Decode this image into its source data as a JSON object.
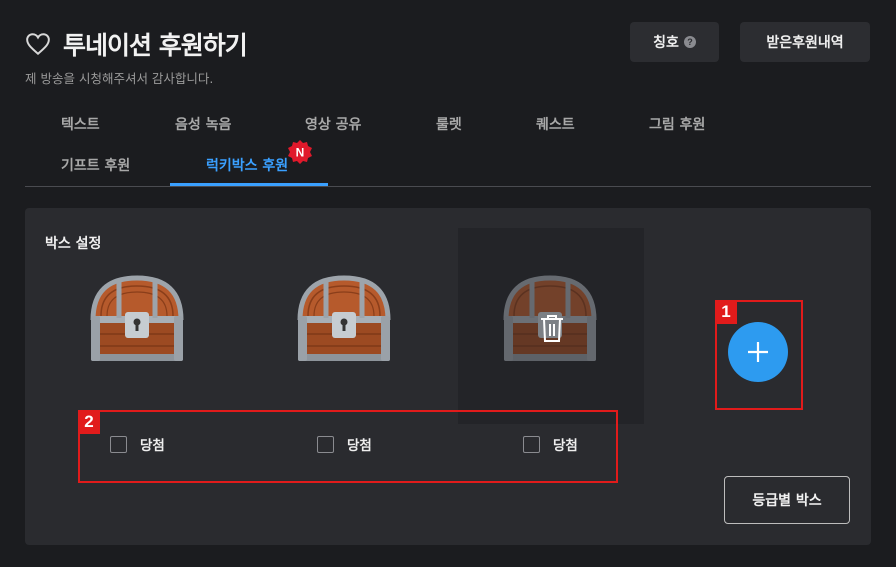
{
  "header": {
    "title": "투네이션 후원하기",
    "subtitle": "제 방송을 시청해주셔서 감사합니다."
  },
  "top_buttons": {
    "title_label": "칭호",
    "history_label": "받은후원내역"
  },
  "tabs": [
    {
      "label": "텍스트",
      "active": false
    },
    {
      "label": "음성 녹음",
      "active": false
    },
    {
      "label": "영상 공유",
      "active": false
    },
    {
      "label": "룰렛",
      "active": false
    },
    {
      "label": "퀘스트",
      "active": false
    },
    {
      "label": "그림 후원",
      "active": false
    },
    {
      "label": "기프트 후원",
      "active": false
    },
    {
      "label": "럭키박스 후원",
      "active": true
    }
  ],
  "new_badge": "N",
  "panel": {
    "title": "박스 설정",
    "boxes": [
      {
        "checkbox_label": "당첨",
        "checked": false
      },
      {
        "checkbox_label": "당첨",
        "checked": false
      },
      {
        "checkbox_label": "당첨",
        "checked": false
      }
    ],
    "grade_button_label": "등급별 박스"
  },
  "annotations": [
    "1",
    "2"
  ],
  "colors": {
    "accent": "#3aa0ff",
    "add_button": "#2d9bf0",
    "annotation": "#e11b1b",
    "background": "#1b1c1f",
    "panel": "#2a2b2f"
  },
  "icons": [
    "heart-icon",
    "help-icon",
    "trash-icon",
    "plus-icon",
    "new-badge-icon",
    "treasure-chest"
  ]
}
